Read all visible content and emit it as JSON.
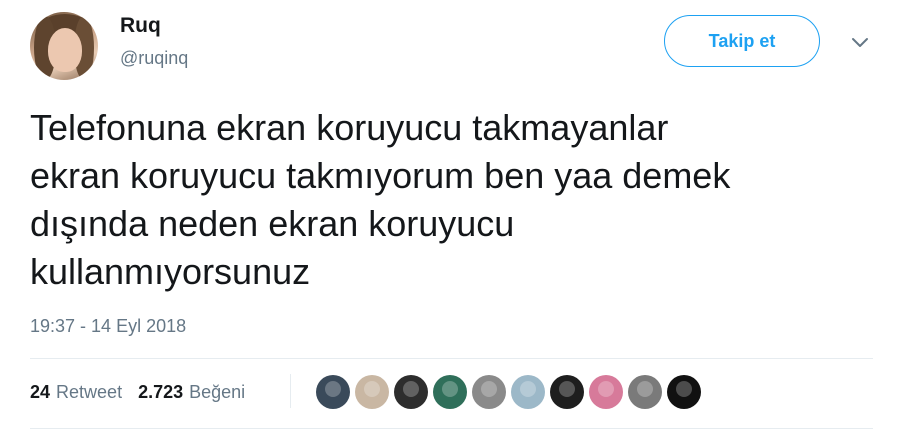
{
  "user": {
    "display_name": "Ruq",
    "handle": "@ruqinq"
  },
  "actions": {
    "follow_label": "Takip et",
    "menu_icon": "chevron-down-icon"
  },
  "tweet": {
    "text": "Telefonuna ekran koruyucu takmayanlar\nekran koruyucu takmıyorum ben yaa demek\ndışında neden ekran koruyucu\nkullanmıyorsunuz",
    "timestamp": "19:37 - 14 Eyl 2018"
  },
  "stats": {
    "retweets": {
      "count": "24",
      "label": "Retweet"
    },
    "likes": {
      "count": "2.723",
      "label": "Beğeni"
    }
  },
  "colors": {
    "accent": "#1da1f2",
    "muted": "#657786",
    "text": "#14171a"
  },
  "liker_avatars": [
    {
      "color": "#3a4a5a"
    },
    {
      "color": "#c9b7a3"
    },
    {
      "color": "#2d2d2d"
    },
    {
      "color": "#2f6f5a"
    },
    {
      "color": "#8a8a8a"
    },
    {
      "color": "#9cb8c8"
    },
    {
      "color": "#1e1e1e"
    },
    {
      "color": "#d77a9a"
    },
    {
      "color": "#7a7a7a"
    },
    {
      "color": "#111111"
    }
  ]
}
